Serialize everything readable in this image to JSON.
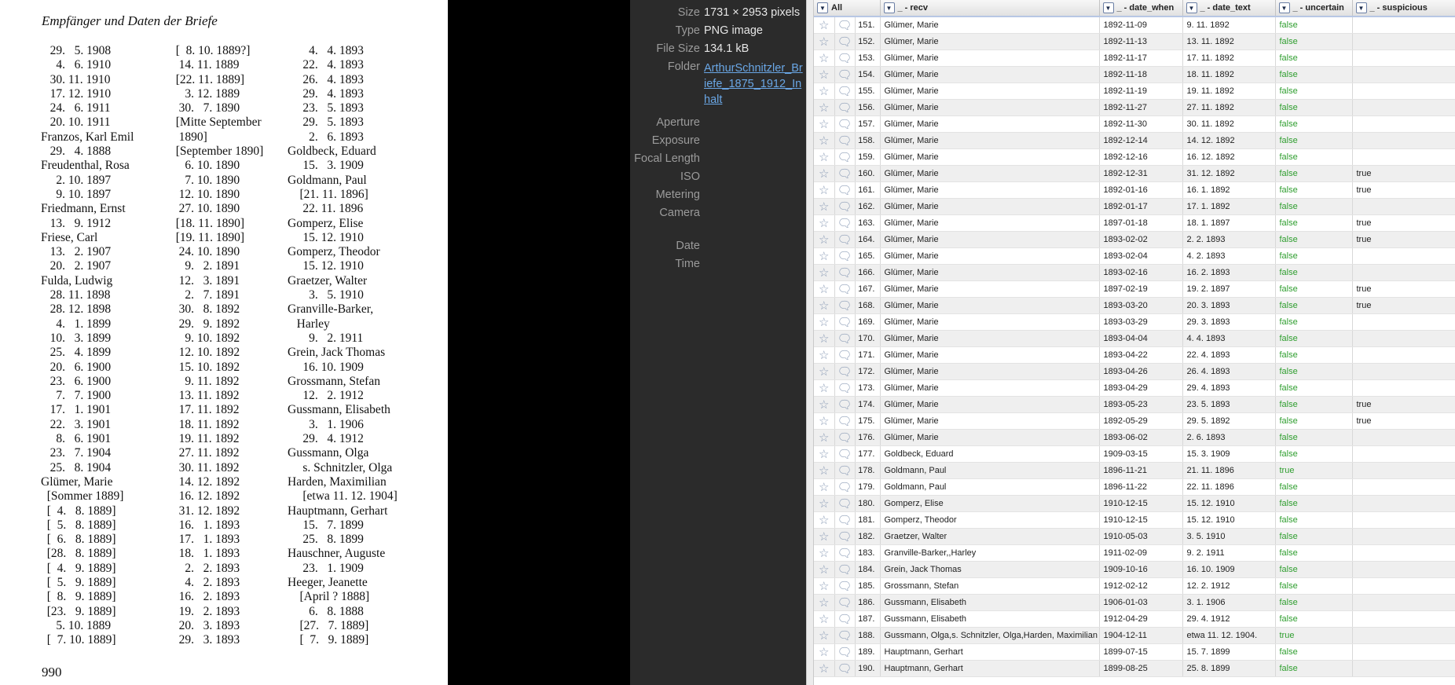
{
  "book_page": {
    "header": "Empfänger und Daten der Briefe",
    "page_number": "990",
    "columns": [
      [
        "   29.   5. 1908",
        "     4.   6. 1910",
        "   30. 11. 1910",
        "   17. 12. 1910",
        "   24.   6. 1911",
        "   20. 10. 1911",
        "Franzos, Karl Emil",
        "   29.   4. 1888",
        "Freudenthal, Rosa",
        "     2. 10. 1897",
        "     9. 10. 1897",
        "Friedmann, Ernst",
        "   13.   9. 1912",
        "Friese, Carl",
        "   13.   2. 1907",
        "   20.   2. 1907",
        "Fulda, Ludwig",
        "   28. 11. 1898",
        "   28. 12. 1898",
        "     4.   1. 1899",
        "   10.   3. 1899",
        "   25.   4. 1899",
        "   20.   6. 1900",
        "   23.   6. 1900",
        "     7.   7. 1900",
        "   17.   1. 1901",
        "   22.   3. 1901",
        "     8.   6. 1901",
        "   23.   7. 1904",
        "   25.   8. 1904",
        "Glümer, Marie",
        "  [Sommer 1889]",
        "  [  4.   8. 1889]",
        "  [  5.   8. 1889]",
        "  [  6.   8. 1889]",
        "  [28.   8. 1889]",
        "  [  4.   9. 1889]",
        "  [  5.   9. 1889]",
        "  [  8.   9. 1889]",
        "  [23.   9. 1889]",
        "     5. 10. 1889",
        "  [  7. 10. 1889]"
      ],
      [
        "  [  8. 10. 1889?]",
        "   14. 11. 1889",
        "  [22. 11. 1889]",
        "     3. 12. 1889",
        "   30.   7. 1890",
        "  [Mitte September",
        "   1890]",
        "  [September 1890]",
        "     6. 10. 1890",
        "     7. 10. 1890",
        "   12. 10. 1890",
        "   27. 10. 1890",
        "  [18. 11. 1890]",
        "  [19. 11. 1890]",
        "   24. 10. 1890",
        "     9.   2. 1891",
        "   12.   3. 1891",
        "     2.   7. 1891",
        "   30.   8. 1892",
        "   29.   9. 1892",
        "     9. 10. 1892",
        "   12. 10. 1892",
        "   15. 10. 1892",
        "     9. 11. 1892",
        "   13. 11. 1892",
        "   17. 11. 1892",
        "   18. 11. 1892",
        "   19. 11. 1892",
        "   27. 11. 1892",
        "   30. 11. 1892",
        "   14. 12. 1892",
        "   16. 12. 1892",
        "   31. 12. 1892",
        "   16.   1. 1893",
        "   17.   1. 1893",
        "   18.   1. 1893",
        "     2.   2. 1893",
        "     4.   2. 1893",
        "   16.   2. 1893",
        "   19.   2. 1893",
        "   20.   3. 1893",
        "   29.   3. 1893"
      ],
      [
        "       4.   4. 1893",
        "     22.   4. 1893",
        "     26.   4. 1893",
        "     29.   4. 1893",
        "     23.   5. 1893",
        "     29.   5. 1893",
        "       2.   6. 1893",
        "Goldbeck, Eduard",
        "     15.   3. 1909",
        "Goldmann, Paul",
        "    [21. 11. 1896]",
        "     22. 11. 1896",
        "Gomperz, Elise",
        "     15. 12. 1910",
        "Gomperz, Theodor",
        "     15. 12. 1910",
        "Graetzer, Walter",
        "       3.   5. 1910",
        "Granville-Barker,",
        "   Harley",
        "       9.   2. 1911",
        "Grein, Jack Thomas",
        "     16. 10. 1909",
        "Grossmann, Stefan",
        "     12.   2. 1912",
        "Gussmann, Elisabeth",
        "       3.   1. 1906",
        "     29.   4. 1912",
        "Gussmann, Olga",
        "     s. Schnitzler, Olga",
        "Harden, Maximilian",
        "     [etwa 11. 12. 1904]",
        "Hauptmann, Gerhart",
        "     15.   7. 1899",
        "     25.   8. 1899",
        "Hauschner, Auguste",
        "     23.   1. 1909",
        "Heeger, Jeanette",
        "    [April ? 1888]",
        "       6.   8. 1888",
        "    [27.   7. 1889]",
        "    [  7.   9. 1889]"
      ]
    ]
  },
  "metadata_panel": {
    "fields": [
      {
        "key": "Size",
        "value": "1731 × 2953 pixels"
      },
      {
        "key": "Type",
        "value": "PNG image"
      },
      {
        "key": "File Size",
        "value": "134.1 kB"
      },
      {
        "key": "Folder",
        "value": "ArthurSchnitzler_Briefe_1875_1912_Inhalt",
        "is_link": true
      },
      {
        "key": "Aperture",
        "value": ""
      },
      {
        "key": "Exposure",
        "value": ""
      },
      {
        "key": "Focal Length",
        "value": ""
      },
      {
        "key": "ISO",
        "value": ""
      },
      {
        "key": "Metering",
        "value": ""
      },
      {
        "key": "Camera",
        "value": ""
      },
      {
        "key": "Date",
        "value": ""
      },
      {
        "key": "Time",
        "value": ""
      }
    ]
  },
  "grid": {
    "headers": {
      "all": "All",
      "recv": "_ - recv",
      "date_when": "_ - date_when",
      "date_text": "_ - date_text",
      "uncertain": "_ - uncertain",
      "suspicious": "_ - suspicious"
    },
    "icons": {
      "star": "star-icon",
      "comment": "comment-icon",
      "dropdown": "triangle-down-icon"
    },
    "rows": [
      {
        "n": "151.",
        "recv": "Glümer, Marie",
        "date_when": "1892-11-09",
        "date_text": "9. 11. 1892",
        "uncertain": "false",
        "suspicious": ""
      },
      {
        "n": "152.",
        "recv": "Glümer, Marie",
        "date_when": "1892-11-13",
        "date_text": "13. 11. 1892",
        "uncertain": "false",
        "suspicious": ""
      },
      {
        "n": "153.",
        "recv": "Glümer, Marie",
        "date_when": "1892-11-17",
        "date_text": "17. 11. 1892",
        "uncertain": "false",
        "suspicious": ""
      },
      {
        "n": "154.",
        "recv": "Glümer, Marie",
        "date_when": "1892-11-18",
        "date_text": "18. 11. 1892",
        "uncertain": "false",
        "suspicious": ""
      },
      {
        "n": "155.",
        "recv": "Glümer, Marie",
        "date_when": "1892-11-19",
        "date_text": "19. 11. 1892",
        "uncertain": "false",
        "suspicious": ""
      },
      {
        "n": "156.",
        "recv": "Glümer, Marie",
        "date_when": "1892-11-27",
        "date_text": "27. 11. 1892",
        "uncertain": "false",
        "suspicious": ""
      },
      {
        "n": "157.",
        "recv": "Glümer, Marie",
        "date_when": "1892-11-30",
        "date_text": "30. 11. 1892",
        "uncertain": "false",
        "suspicious": ""
      },
      {
        "n": "158.",
        "recv": "Glümer, Marie",
        "date_when": "1892-12-14",
        "date_text": "14. 12. 1892",
        "uncertain": "false",
        "suspicious": ""
      },
      {
        "n": "159.",
        "recv": "Glümer, Marie",
        "date_when": "1892-12-16",
        "date_text": "16. 12. 1892",
        "uncertain": "false",
        "suspicious": ""
      },
      {
        "n": "160.",
        "recv": "Glümer, Marie",
        "date_when": "1892-12-31",
        "date_text": "31. 12. 1892",
        "uncertain": "false",
        "suspicious": "true"
      },
      {
        "n": "161.",
        "recv": "Glümer, Marie",
        "date_when": "1892-01-16",
        "date_text": "16. 1. 1892",
        "uncertain": "false",
        "suspicious": "true"
      },
      {
        "n": "162.",
        "recv": "Glümer, Marie",
        "date_when": "1892-01-17",
        "date_text": "17. 1. 1892",
        "uncertain": "false",
        "suspicious": ""
      },
      {
        "n": "163.",
        "recv": "Glümer, Marie",
        "date_when": "1897-01-18",
        "date_text": "18. 1. 1897",
        "uncertain": "false",
        "suspicious": "true"
      },
      {
        "n": "164.",
        "recv": "Glümer, Marie",
        "date_when": "1893-02-02",
        "date_text": "2. 2. 1893",
        "uncertain": "false",
        "suspicious": "true"
      },
      {
        "n": "165.",
        "recv": "Glümer, Marie",
        "date_when": "1893-02-04",
        "date_text": "4. 2. 1893",
        "uncertain": "false",
        "suspicious": ""
      },
      {
        "n": "166.",
        "recv": "Glümer, Marie",
        "date_when": "1893-02-16",
        "date_text": "16. 2. 1893",
        "uncertain": "false",
        "suspicious": ""
      },
      {
        "n": "167.",
        "recv": "Glümer, Marie",
        "date_when": "1897-02-19",
        "date_text": "19. 2. 1897",
        "uncertain": "false",
        "suspicious": "true"
      },
      {
        "n": "168.",
        "recv": "Glümer, Marie",
        "date_when": "1893-03-20",
        "date_text": "20. 3. 1893",
        "uncertain": "false",
        "suspicious": "true"
      },
      {
        "n": "169.",
        "recv": "Glümer, Marie",
        "date_when": "1893-03-29",
        "date_text": "29. 3. 1893",
        "uncertain": "false",
        "suspicious": ""
      },
      {
        "n": "170.",
        "recv": "Glümer, Marie",
        "date_when": "1893-04-04",
        "date_text": "4. 4. 1893",
        "uncertain": "false",
        "suspicious": ""
      },
      {
        "n": "171.",
        "recv": "Glümer, Marie",
        "date_when": "1893-04-22",
        "date_text": "22. 4. 1893",
        "uncertain": "false",
        "suspicious": ""
      },
      {
        "n": "172.",
        "recv": "Glümer, Marie",
        "date_when": "1893-04-26",
        "date_text": "26. 4. 1893",
        "uncertain": "false",
        "suspicious": ""
      },
      {
        "n": "173.",
        "recv": "Glümer, Marie",
        "date_when": "1893-04-29",
        "date_text": "29. 4. 1893",
        "uncertain": "false",
        "suspicious": ""
      },
      {
        "n": "174.",
        "recv": "Glümer, Marie",
        "date_when": "1893-05-23",
        "date_text": "23. 5. 1893",
        "uncertain": "false",
        "suspicious": "true"
      },
      {
        "n": "175.",
        "recv": "Glümer, Marie",
        "date_when": "1892-05-29",
        "date_text": "29. 5. 1892",
        "uncertain": "false",
        "suspicious": "true"
      },
      {
        "n": "176.",
        "recv": "Glümer, Marie",
        "date_when": "1893-06-02",
        "date_text": "2. 6. 1893",
        "uncertain": "false",
        "suspicious": ""
      },
      {
        "n": "177.",
        "recv": "Goldbeck, Eduard",
        "date_when": "1909-03-15",
        "date_text": "15. 3. 1909",
        "uncertain": "false",
        "suspicious": ""
      },
      {
        "n": "178.",
        "recv": "Goldmann, Paul",
        "date_when": "1896-11-21",
        "date_text": "21. 11. 1896",
        "uncertain": "true",
        "suspicious": ""
      },
      {
        "n": "179.",
        "recv": "Goldmann, Paul",
        "date_when": "1896-11-22",
        "date_text": "22. 11. 1896",
        "uncertain": "false",
        "suspicious": ""
      },
      {
        "n": "180.",
        "recv": "Gomperz, Elise",
        "date_when": "1910-12-15",
        "date_text": "15. 12. 1910",
        "uncertain": "false",
        "suspicious": ""
      },
      {
        "n": "181.",
        "recv": "Gomperz, Theodor",
        "date_when": "1910-12-15",
        "date_text": "15. 12. 1910",
        "uncertain": "false",
        "suspicious": ""
      },
      {
        "n": "182.",
        "recv": "Graetzer, Walter",
        "date_when": "1910-05-03",
        "date_text": "3. 5. 1910",
        "uncertain": "false",
        "suspicious": ""
      },
      {
        "n": "183.",
        "recv": "Granville-Barker,,Harley",
        "date_when": "1911-02-09",
        "date_text": "9. 2. 1911",
        "uncertain": "false",
        "suspicious": ""
      },
      {
        "n": "184.",
        "recv": "Grein, Jack Thomas",
        "date_when": "1909-10-16",
        "date_text": "16. 10. 1909",
        "uncertain": "false",
        "suspicious": ""
      },
      {
        "n": "185.",
        "recv": "Grossmann, Stefan",
        "date_when": "1912-02-12",
        "date_text": "12. 2. 1912",
        "uncertain": "false",
        "suspicious": ""
      },
      {
        "n": "186.",
        "recv": "Gussmann, Elisabeth",
        "date_when": "1906-01-03",
        "date_text": "3. 1. 1906",
        "uncertain": "false",
        "suspicious": ""
      },
      {
        "n": "187.",
        "recv": "Gussmann, Elisabeth",
        "date_when": "1912-04-29",
        "date_text": "29. 4. 1912",
        "uncertain": "false",
        "suspicious": ""
      },
      {
        "n": "188.",
        "recv": "Gussmann, Olga,s. Schnitzler, Olga,Harden, Maximilian",
        "date_when": "1904-12-11",
        "date_text": "etwa 11. 12. 1904.",
        "uncertain": "true",
        "suspicious": ""
      },
      {
        "n": "189.",
        "recv": "Hauptmann, Gerhart",
        "date_when": "1899-07-15",
        "date_text": "15. 7. 1899",
        "uncertain": "false",
        "suspicious": ""
      },
      {
        "n": "190.",
        "recv": "Hauptmann, Gerhart",
        "date_when": "1899-08-25",
        "date_text": "25. 8. 1899",
        "uncertain": "false",
        "suspicious": ""
      }
    ]
  }
}
